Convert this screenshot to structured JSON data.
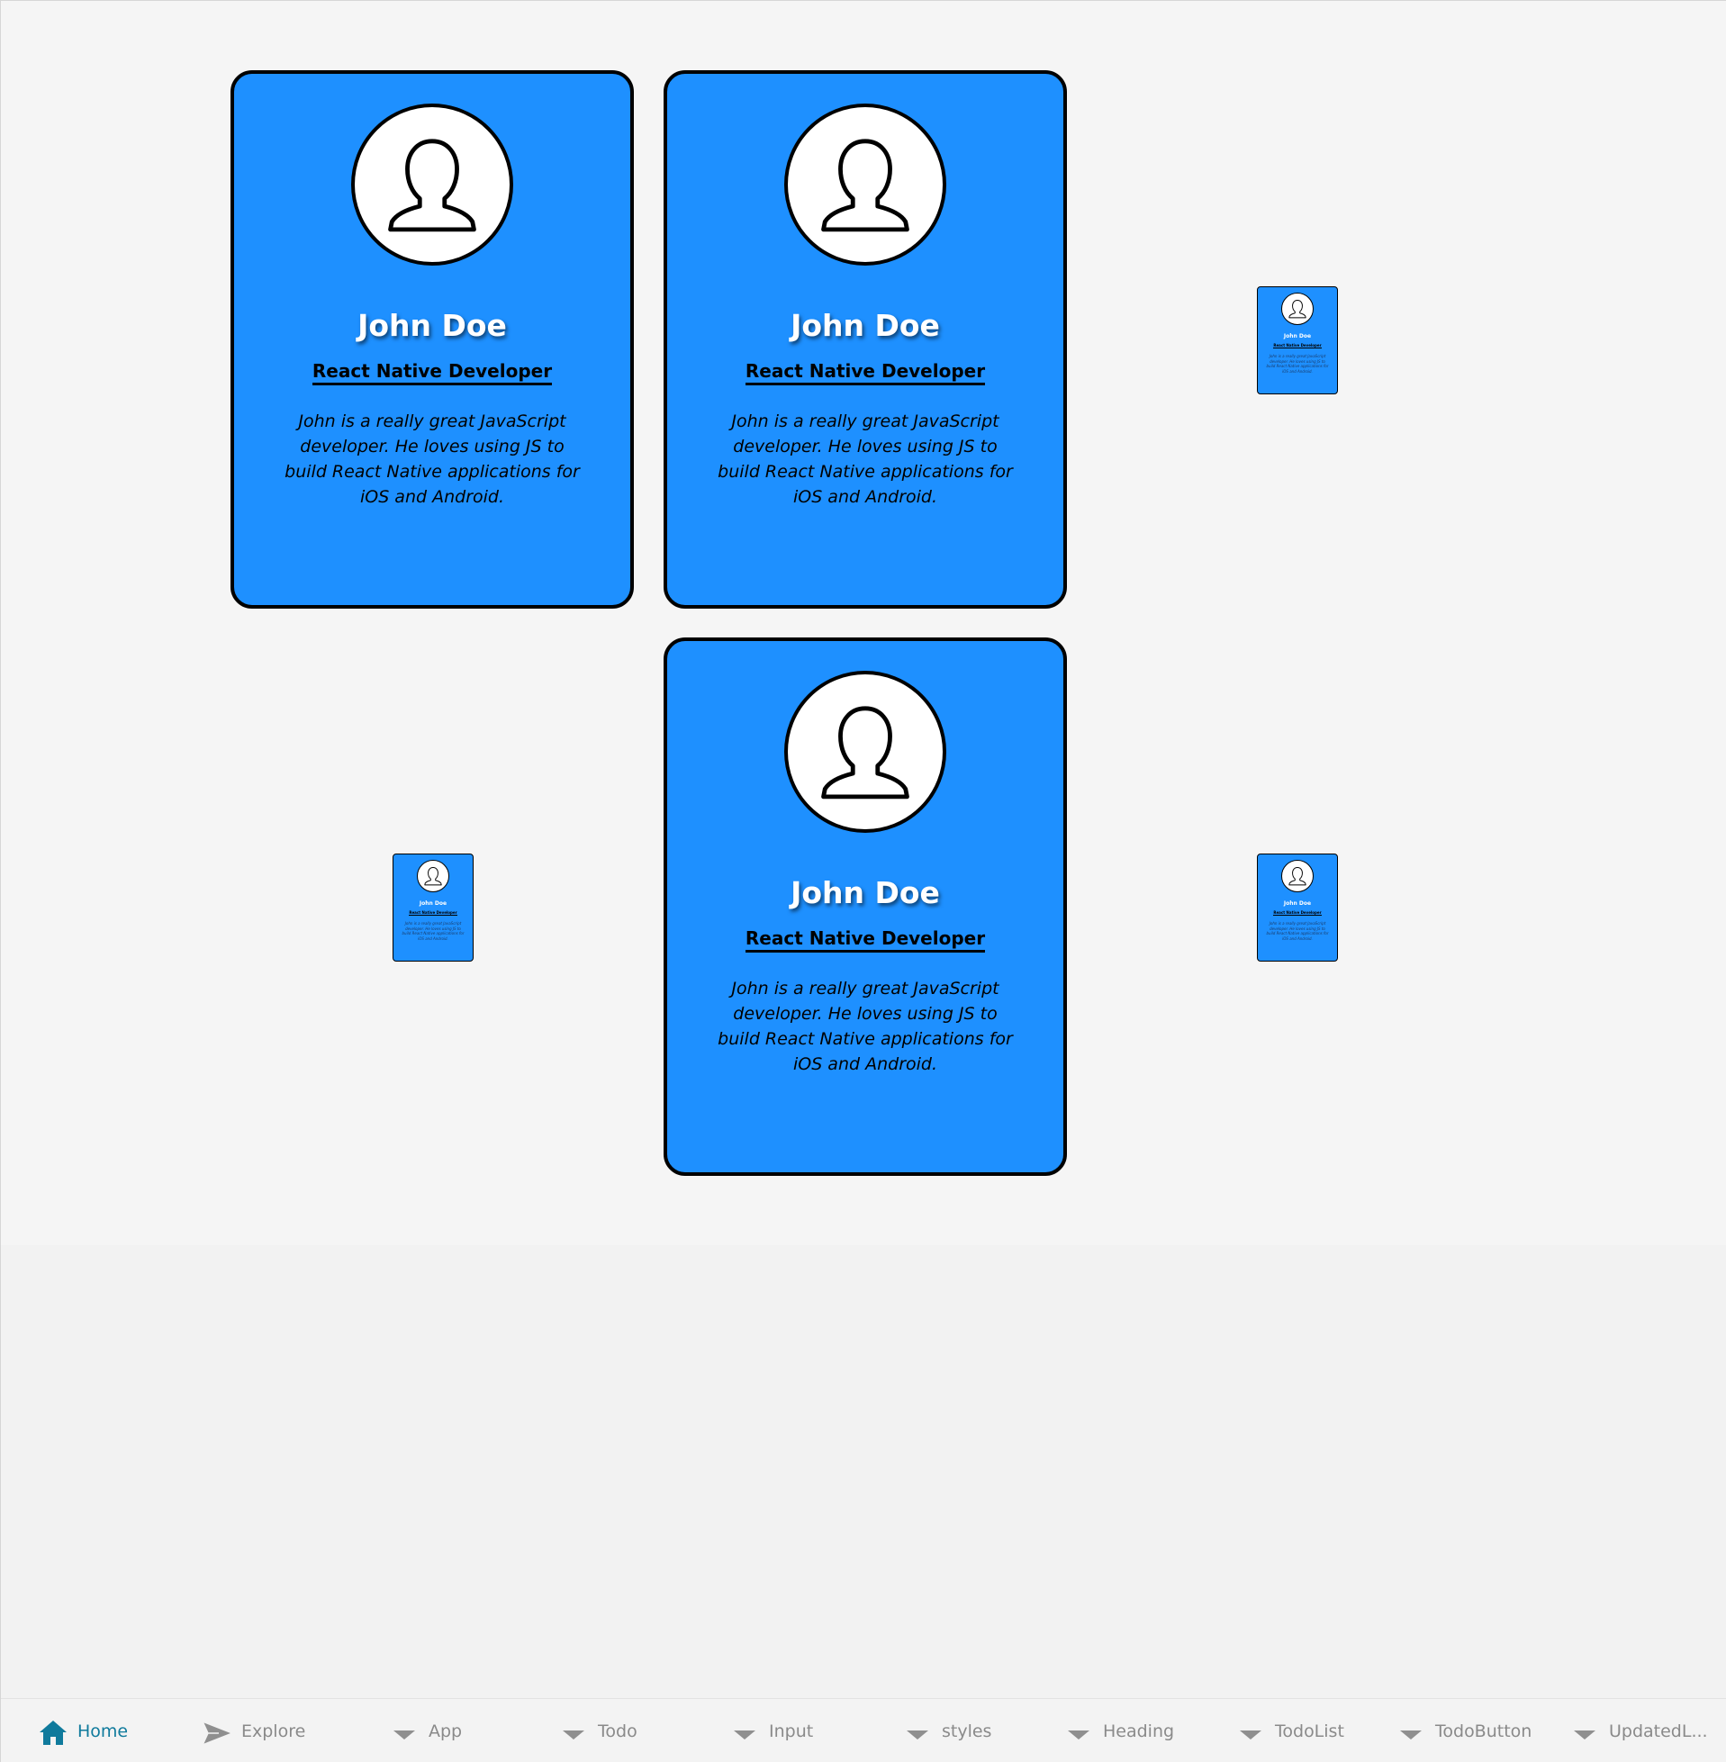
{
  "colors": {
    "card_background": "#1e90ff",
    "card_border": "#000000",
    "page_background": "#f5f5f5",
    "nav_active": "#0f7a9c",
    "nav_inactive": "#8a8a8a"
  },
  "profile": {
    "name": "John Doe",
    "role": "React Native Developer",
    "bio": "John is a really great JavaScript developer. He loves using JS to build React Native applications for iOS and Android.",
    "avatar_icon": "user-silhouette-icon"
  },
  "nav": {
    "active": "Home",
    "items": [
      {
        "label": "Home",
        "icon": "home-icon"
      },
      {
        "label": "Explore",
        "icon": "send-icon"
      },
      {
        "label": "App",
        "icon": "caret-down-icon"
      },
      {
        "label": "Todo",
        "icon": "caret-down-icon"
      },
      {
        "label": "Input",
        "icon": "caret-down-icon"
      },
      {
        "label": "styles",
        "icon": "caret-down-icon"
      },
      {
        "label": "Heading",
        "icon": "caret-down-icon"
      },
      {
        "label": "TodoList",
        "icon": "caret-down-icon"
      },
      {
        "label": "TodoButton",
        "icon": "caret-down-icon"
      },
      {
        "label": "UpdatedL...",
        "icon": "caret-down-icon"
      }
    ]
  }
}
